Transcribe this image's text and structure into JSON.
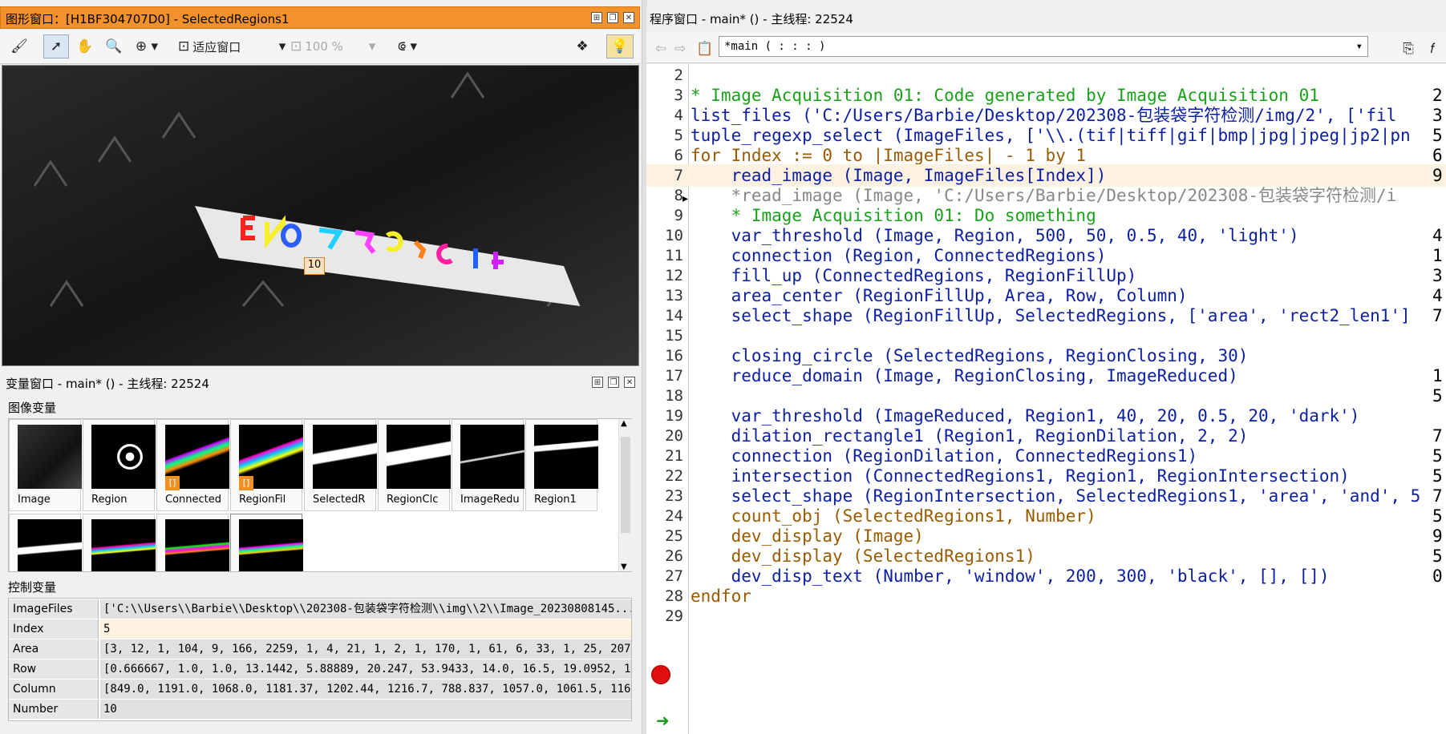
{
  "graphics_window": {
    "title": "图形窗口：[H1BF304707D0] - SelectedRegions1",
    "fit_window_label": "适应窗口",
    "zoom_label": "100 %",
    "region_count_badge": "10"
  },
  "variable_window": {
    "title": "变量窗口 - main* () - 主线程: 22524",
    "iconic_section_label": "图像变量",
    "control_section_label": "控制变量",
    "iconic_vars": [
      "Image",
      "Region",
      "Connected",
      "RegionFil",
      "SelectedR",
      "RegionClc",
      "ImageRedu",
      "Region1"
    ],
    "control_vars": [
      {
        "name": "ImageFiles",
        "value": "['C:\\\\Users\\\\Barbie\\\\Desktop\\\\202308-包装袋字符检测\\\\img\\\\2\\\\Image_20230808145..."
      },
      {
        "name": "Index",
        "value": "5"
      },
      {
        "name": "Area",
        "value": "[3, 12, 1, 104, 9, 166, 2259, 1, 4, 21, 1, 2, 1, 170, 1, 61, 6, 33, 1, 25, 207..."
      },
      {
        "name": "Row",
        "value": "[0.666667, 1.0, 1.0, 13.1442, 5.88889, 20.247, 53.9433, 14.0, 16.5, 19.0952, 1..."
      },
      {
        "name": "Column",
        "value": "[849.0, 1191.0, 1068.0, 1181.37, 1202.44, 1216.7, 788.837, 1057.0, 1061.5, 116..."
      },
      {
        "name": "Number",
        "value": "10"
      }
    ]
  },
  "program_window": {
    "title": "程序窗口 - main* () - 主线程: 22524",
    "procedure_combo": "*main ( : : : )",
    "lines": [
      {
        "num": "2",
        "code": ""
      },
      {
        "num": "3",
        "code": "* Image Acquisition 01: Code generated by Image Acquisition 01"
      },
      {
        "num": "4",
        "code": "list_files ('C:/Users/Barbie/Desktop/202308-包装袋字符检测/img/2', ['fil"
      },
      {
        "num": "5",
        "code": "tuple_regexp_select (ImageFiles, ['\\\\.(tif|tiff|gif|bmp|jpg|jpeg|jp2|pn"
      },
      {
        "num": "6",
        "code": "for Index := 0 to |ImageFiles| - 1 by 1"
      },
      {
        "num": "7",
        "code": "    read_image (Image, ImageFiles[Index])"
      },
      {
        "num": "8",
        "code": "    *read_image (Image, 'C:/Users/Barbie/Desktop/202308-包装袋字符检测/i"
      },
      {
        "num": "9",
        "code": "    * Image Acquisition 01: Do something"
      },
      {
        "num": "10",
        "code": "    var_threshold (Image, Region, 500, 50, 0.5, 40, 'light')"
      },
      {
        "num": "11",
        "code": "    connection (Region, ConnectedRegions)"
      },
      {
        "num": "12",
        "code": "    fill_up (ConnectedRegions, RegionFillUp)"
      },
      {
        "num": "13",
        "code": "    area_center (RegionFillUp, Area, Row, Column)"
      },
      {
        "num": "14",
        "code": "    select_shape (RegionFillUp, SelectedRegions, ['area', 'rect2_len1']"
      },
      {
        "num": "15",
        "code": ""
      },
      {
        "num": "16",
        "code": "    closing_circle (SelectedRegions, RegionClosing, 30)"
      },
      {
        "num": "17",
        "code": "    reduce_domain (Image, RegionClosing, ImageReduced)"
      },
      {
        "num": "18",
        "code": ""
      },
      {
        "num": "19",
        "code": "    var_threshold (ImageReduced, Region1, 40, 20, 0.5, 20, 'dark')"
      },
      {
        "num": "20",
        "code": "    dilation_rectangle1 (Region1, RegionDilation, 2, 2)"
      },
      {
        "num": "21",
        "code": "    connection (RegionDilation, ConnectedRegions1)"
      },
      {
        "num": "22",
        "code": "    intersection (ConnectedRegions1, Region1, RegionIntersection)"
      },
      {
        "num": "23",
        "code": "    select_shape (RegionIntersection, SelectedRegions1, 'area', 'and', 5"
      },
      {
        "num": "24",
        "code": "    count_obj (SelectedRegions1, Number)"
      },
      {
        "num": "25",
        "code": "    dev_display (Image)"
      },
      {
        "num": "26",
        "code": "    dev_display (SelectedRegions1)"
      },
      {
        "num": "27",
        "code": "    dev_disp_text (Number, 'window', 200, 300, 'black', [], [])"
      },
      {
        "num": "28",
        "code": "endfor"
      },
      {
        "num": "29",
        "code": ""
      }
    ],
    "right_margin_values": [
      "2.",
      "3.",
      "5.",
      "6.",
      "9.",
      "4.",
      "1.",
      "3.",
      "4.",
      "7.",
      "1.",
      "5.",
      "7.",
      "5.",
      "5.",
      "7.",
      "5.",
      "9.",
      "5.",
      "0."
    ]
  }
}
